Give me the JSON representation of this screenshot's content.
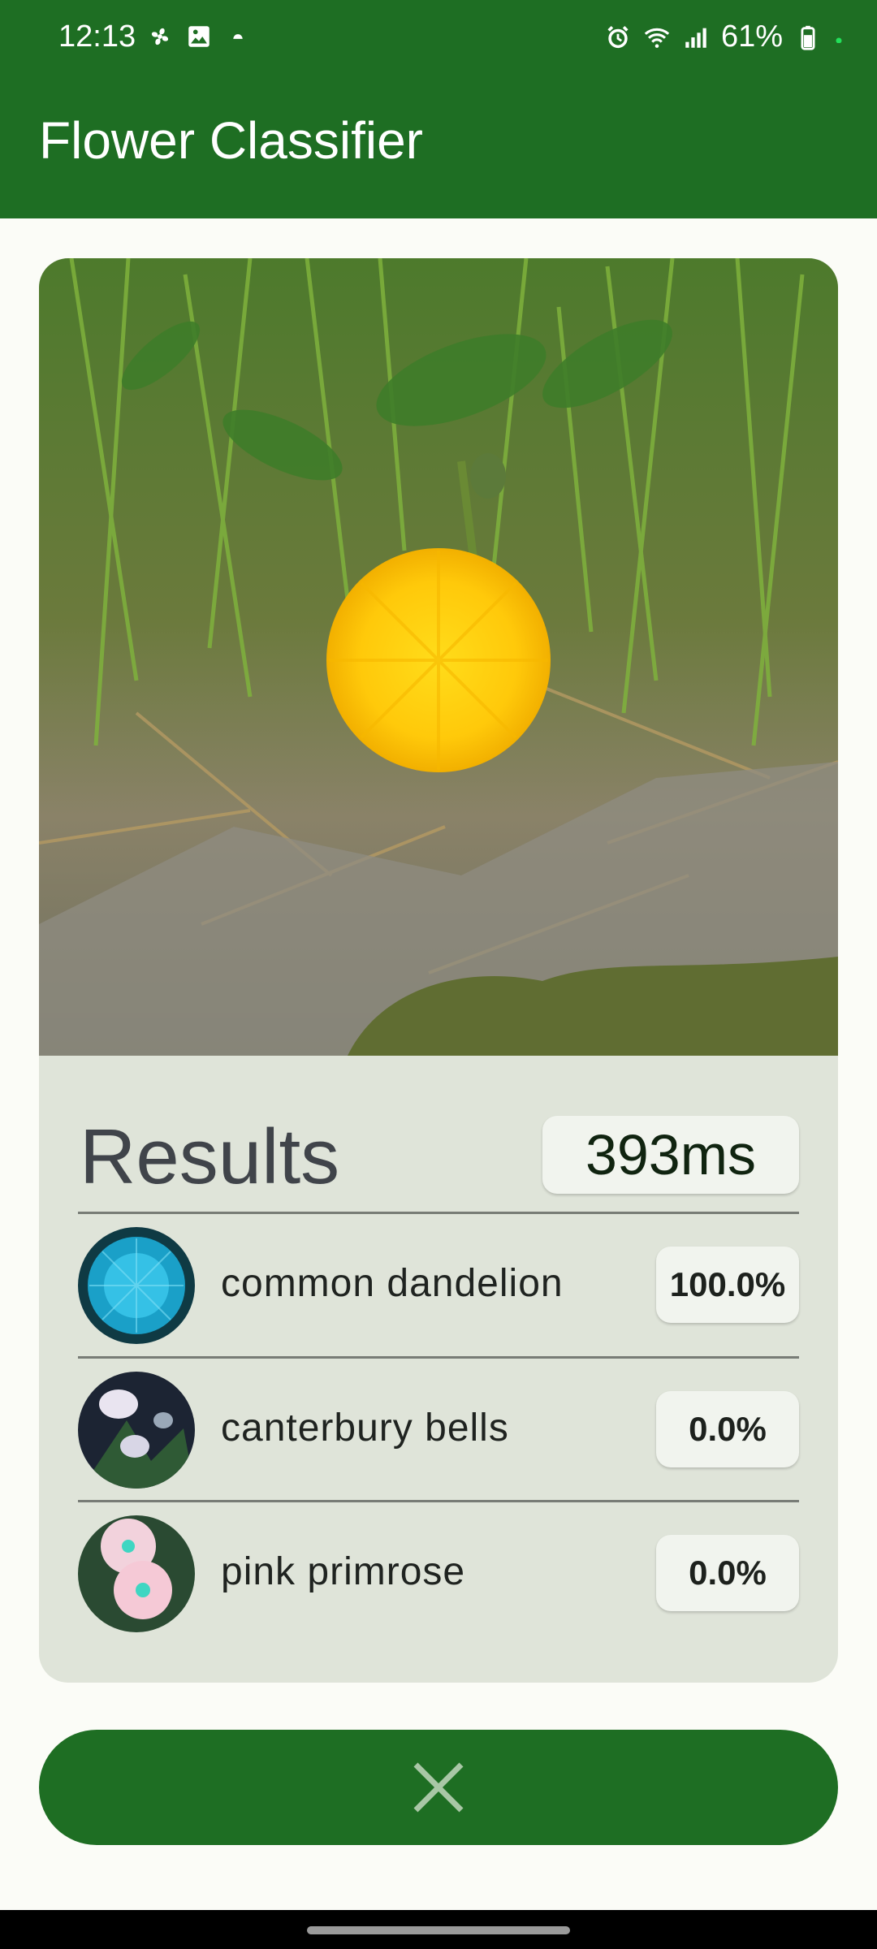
{
  "status_bar": {
    "time": "12:13",
    "battery": "61%"
  },
  "app_bar": {
    "title": "Flower Classifier"
  },
  "results": {
    "title": "Results",
    "inference_time": "393ms",
    "items": [
      {
        "label": "common dandelion",
        "score": "100.0%",
        "thumb_icon": "dandelion-thumbnail"
      },
      {
        "label": "canterbury bells",
        "score": "0.0%",
        "thumb_icon": "canterbury-bells-thumbnail"
      },
      {
        "label": "pink primrose",
        "score": "0.0%",
        "thumb_icon": "pink-primrose-thumbnail"
      }
    ]
  },
  "actions": {
    "close_icon": "close-icon"
  },
  "colors": {
    "primary": "#1e6e23",
    "card_bg": "#dfe4d9",
    "chip_bg": "#f1f4ee",
    "page_bg": "#fbfcf7"
  }
}
